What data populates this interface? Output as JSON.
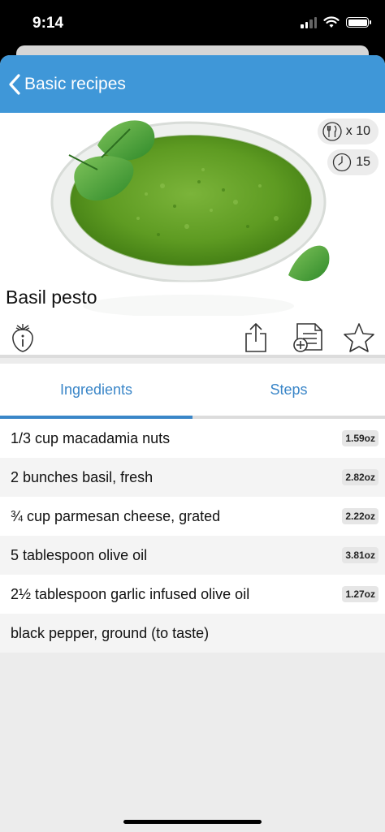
{
  "status": {
    "time": "9:14"
  },
  "nav": {
    "back_label": "Basic recipes"
  },
  "recipe": {
    "title": "Basil pesto",
    "servings": "x 10",
    "time": "15"
  },
  "tabs": [
    {
      "label": "Ingredients",
      "active": true
    },
    {
      "label": "Steps",
      "active": false
    }
  ],
  "ingredients": [
    {
      "text": "1/3 cup macadamia nuts",
      "amount": "1.59oz"
    },
    {
      "text": "2 bunches basil, fresh",
      "amount": "2.82oz"
    },
    {
      "text": "¾ cup parmesan cheese, grated",
      "amount": "2.22oz"
    },
    {
      "text": "5 tablespoon olive oil",
      "amount": "3.81oz"
    },
    {
      "text": "2½ tablespoon garlic infused olive oil",
      "amount": "1.27oz"
    },
    {
      "text": "black pepper, ground (to taste)",
      "amount": ""
    }
  ],
  "colors": {
    "nav": "#3f97d8",
    "accent": "#3a86c8"
  },
  "icons": [
    "signal-icon",
    "wifi-icon",
    "battery-icon",
    "back-chevron-icon",
    "cutlery-icon",
    "clock-icon",
    "strawberry-info-icon",
    "share-icon",
    "add-to-list-icon",
    "favorite-star-icon"
  ]
}
